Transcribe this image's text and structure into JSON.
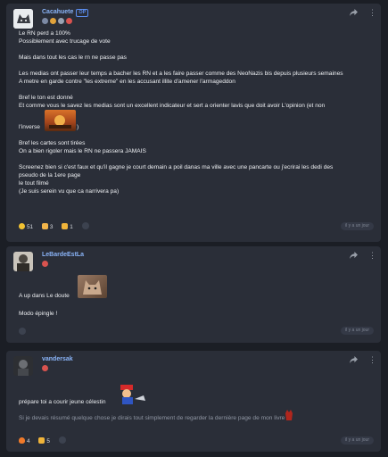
{
  "posts": [
    {
      "author": "Cacahuete",
      "author_badge": "OP",
      "lines": [
        "Le RN perd a 100%",
        "Possiblement avec trucage de vote",
        "",
        "Mais dans tout les cas le rn ne passe pas",
        "",
        "Les medias ont passer leur temps a bacher les RN et a les faire passer comme des NeoNazis bis depuis plusieurs semaines",
        "A metre en garde contre \"les extreme\" en les accusant illite d'amener l'armageddon",
        "",
        "Bref le ton est donné",
        "Et comme vous le savez les medias sont un excellent indicateur et sert a orienter lavis que doit avoir L'opinion (et non",
        "",
        "",
        "Bref les cartes sont tirées",
        "On a bien rigoler mais le RN ne passera JAMAIS",
        "",
        "Screenez bien si c'est faux et qu'il gagne je court demain a poil danas ma ville avec une pancarte ou j'ecrirai les dedi des",
        "pseudo de la 1ere page",
        "le tout filmé",
        "(Je suis serein vu que ca narrivera pa)"
      ],
      "inverse_prefix": "l'inverse",
      "inverse_suffix": ")",
      "reactions": [
        {
          "emoji": "laughing-face",
          "count": "51"
        },
        {
          "emoji": "pointing-hand",
          "count": "3"
        },
        {
          "emoji": "thumbs-up",
          "count": "1"
        }
      ],
      "timestamp": "il y a un jour"
    },
    {
      "author": "LeBardeEstLa",
      "lines": [
        "Modo épingle !"
      ],
      "up_text": "A up dans Le doute",
      "reactions": [],
      "timestamp": "il y a un jour"
    },
    {
      "author": "vandersak",
      "lines": [
        "prépare toi a courir jeune célestin"
      ],
      "quote": "Si je devais résumé quelque chose je dirais tout simplement de regarder la dernière page de mon livre",
      "reactions": [
        {
          "emoji": "fire",
          "count": "4"
        },
        {
          "emoji": "thumbs-up",
          "count": "5"
        }
      ],
      "timestamp": "il y a un jour"
    }
  ],
  "colors": {
    "background": "#1b1e25",
    "card": "#2a2e38",
    "author": "#8ab4f8",
    "op_badge": "#5b8def",
    "quote": "#8f96a3"
  }
}
